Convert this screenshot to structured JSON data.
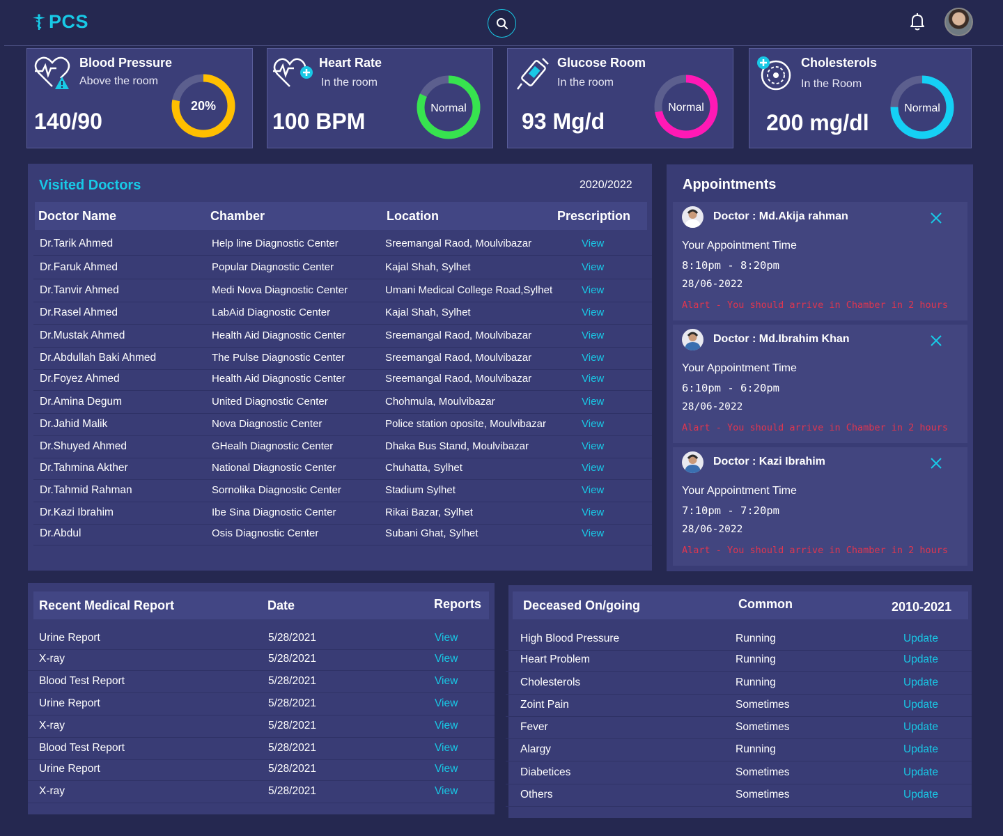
{
  "app": {
    "logo_text": "PCS"
  },
  "colors": {
    "background": "#252850",
    "panel": "#393c75",
    "accent": "#18c9e6",
    "alert": "#e0364f",
    "yellow": "#ffbf00",
    "green": "#37e34f",
    "magenta": "#ff19b5",
    "cyan": "#15d0f5"
  },
  "stats": [
    {
      "title": "Blood Pressure",
      "subtitle": "Above the room",
      "value": "140/90",
      "ring_label": "20%",
      "ring_color": "#ffbf00",
      "fill": 0.78,
      "icon": "heartbeat-warning-icon"
    },
    {
      "title": "Heart Rate",
      "subtitle": "In the room",
      "value": "100 BPM",
      "ring_label": "Normal",
      "ring_color": "#37e34f",
      "fill": 0.82,
      "icon": "heart-plus-icon"
    },
    {
      "title": "Glucose Room",
      "subtitle": "In the room",
      "value": "93 Mg/d",
      "ring_label": "Normal",
      "ring_color": "#ff19b5",
      "fill": 0.72,
      "icon": "glucose-meter-icon"
    },
    {
      "title": "Cholesterols",
      "subtitle": "In the Room",
      "value": "200 mg/dl",
      "ring_label": "Normal",
      "ring_color": "#15d0f5",
      "fill": 0.75,
      "icon": "cholesterol-icon"
    }
  ],
  "doctors": {
    "title": "Visited Doctors",
    "period": "2020/2022",
    "columns": [
      "Doctor Name",
      "Chamber",
      "Location",
      "Prescription"
    ],
    "rows": [
      [
        "Dr.Tarik Ahmed",
        "Help line Diagnostic Center",
        "Sreemangal Raod, Moulvibazar",
        "View"
      ],
      [
        "Dr.Faruk Ahmed",
        "Popular Diagnostic Center",
        "Kajal Shah, Sylhet",
        "View"
      ],
      [
        "Dr.Tanvir Ahmed",
        "Medi Nova Diagnostic Center",
        "Umani Medical College Road,Sylhet",
        "View"
      ],
      [
        "Dr.Rasel  Ahmed",
        "LabAid Diagnostic Center",
        "Kajal Shah, Sylhet",
        "View"
      ],
      [
        "Dr.Mustak Ahmed",
        "Health Aid Diagnostic Center",
        "Sreemangal Raod, Moulvibazar",
        "View"
      ],
      [
        "Dr.Abdullah Baki Ahmed",
        "The Pulse Diagnostic Center",
        "Sreemangal Raod, Moulvibazar",
        "View"
      ],
      [
        "Dr.Foyez Ahmed",
        "Health Aid Diagnostic Center",
        "Sreemangal Raod, Moulvibazar",
        "View"
      ],
      [
        "Dr.Amina Degum",
        "United Diagnostic Center",
        "Chohmula, Moulvibazar",
        "View"
      ],
      [
        "Dr.Jahid Malik",
        "Nova Diagnostic Center",
        "Police station oposite, Moulvibazar",
        "View"
      ],
      [
        "Dr.Shuyed Ahmed",
        "GHealh Diagnostic Center",
        "Dhaka Bus Stand, Moulvibazar",
        "View"
      ],
      [
        "Dr.Tahmina Akther",
        "National Diagnostic Center",
        "Chuhatta, Sylhet",
        "View"
      ],
      [
        "Dr.Tahmid Rahman",
        "Sornolika Diagnostic Center",
        "Stadium Sylhet",
        "View"
      ],
      [
        "Dr.Kazi Ibrahim",
        "Ibe Sina Diagnostic Center",
        "Rikai Bazar, Sylhet",
        "View"
      ],
      [
        "Dr.Abdul",
        "Osis Diagnostic Center",
        "Subani Ghat, Sylhet",
        "View"
      ]
    ]
  },
  "appointments": {
    "title": "Appointments",
    "items": [
      {
        "doctor": "Doctor : Md.Akija rahman",
        "label": "Your Appointment Time",
        "time": "8:10pm - 8:20pm",
        "date": "28/06-2022",
        "alert": "Alart - You should arrive in Chamber in 2 hours"
      },
      {
        "doctor": "Doctor : Md.Ibrahim Khan",
        "label": "Your Appointment Time",
        "time": "6:10pm - 6:20pm",
        "date": "28/06-2022",
        "alert": "Alart - You should arrive in Chamber in 2 hours"
      },
      {
        "doctor": "Doctor :  Kazi Ibrahim",
        "label": "Your Appointment Time",
        "time": "7:10pm - 7:20pm",
        "date": "28/06-2022",
        "alert": "Alart - You should arrive in Chamber in 2 hours"
      }
    ]
  },
  "reports": {
    "columns": [
      "Recent Medical Report",
      "Date",
      "Reports"
    ],
    "rows": [
      [
        "Urine Report",
        "5/28/2021",
        "View"
      ],
      [
        "X-ray",
        "5/28/2021",
        "View"
      ],
      [
        "Blood Test Report",
        "5/28/2021",
        "View"
      ],
      [
        "Urine Report",
        "5/28/2021",
        "View"
      ],
      [
        "X-ray",
        "5/28/2021",
        "View"
      ],
      [
        "Blood Test Report",
        "5/28/2021",
        "View"
      ],
      [
        "Urine Report",
        "5/28/2021",
        "View"
      ],
      [
        "X-ray",
        "5/28/2021",
        "View"
      ]
    ]
  },
  "diseases": {
    "columns": [
      "Deceased On/going",
      "Common",
      "2010-2021"
    ],
    "rows": [
      [
        "High Blood Pressure",
        "Running",
        "Update"
      ],
      [
        "Heart Problem",
        "Running",
        "Update"
      ],
      [
        "Cholesterols",
        "Running",
        "Update"
      ],
      [
        "Zoint  Pain",
        "Sometimes",
        "Update"
      ],
      [
        "Fever",
        "Sometimes",
        "Update"
      ],
      [
        "Alargy",
        "Running",
        "Update"
      ],
      [
        "Diabetices",
        "Sometimes",
        "Update"
      ],
      [
        "Others",
        "Sometimes",
        "Update"
      ]
    ]
  }
}
